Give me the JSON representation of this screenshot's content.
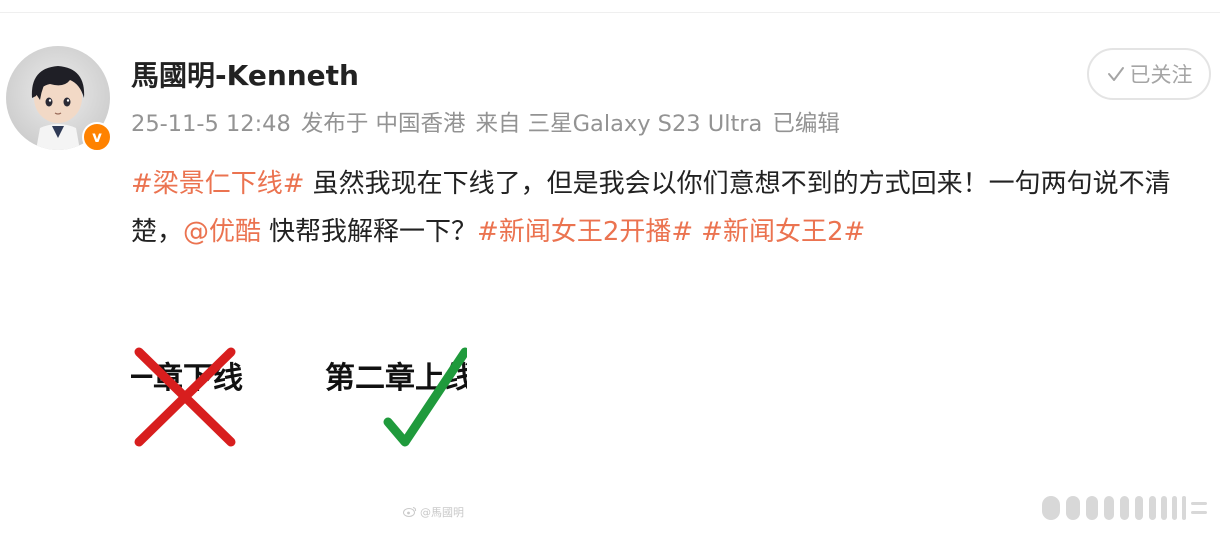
{
  "colors": {
    "accent": "#eb7350",
    "meta_text": "#939393",
    "verified_badge": "#ff8200",
    "cross_red": "#d81e1e",
    "check_green": "#1f9a3c"
  },
  "author": {
    "name": "馬國明-Kenneth",
    "verified_badge_letter": "v",
    "avatar_icon": "figurine-avatar"
  },
  "meta": {
    "date": "25-11-5 12:48",
    "location": "发布于 中国香港",
    "source": "来自 三星Galaxy S23 Ultra",
    "edited": "已编辑"
  },
  "follow_button": {
    "label": "已关注",
    "icon": "check-icon"
  },
  "post": {
    "tag1": "#梁景仁下线#",
    "text1": "虽然我现在下线了，但是我会以你们意想不到的方式回来！一句两句说不清楚，",
    "mention": "@优酷",
    "text2": "快帮我解释一下？",
    "tag2": "#新闻女王2开播#",
    "tag3": "#新闻女王2#"
  },
  "image": {
    "left_text": "一章下线",
    "right_text": "第二章上线",
    "left_icon": "cross-icon",
    "right_icon": "check-icon"
  },
  "watermark": {
    "text": "@馬國明"
  },
  "scan_icon": "scan-lines-icon"
}
